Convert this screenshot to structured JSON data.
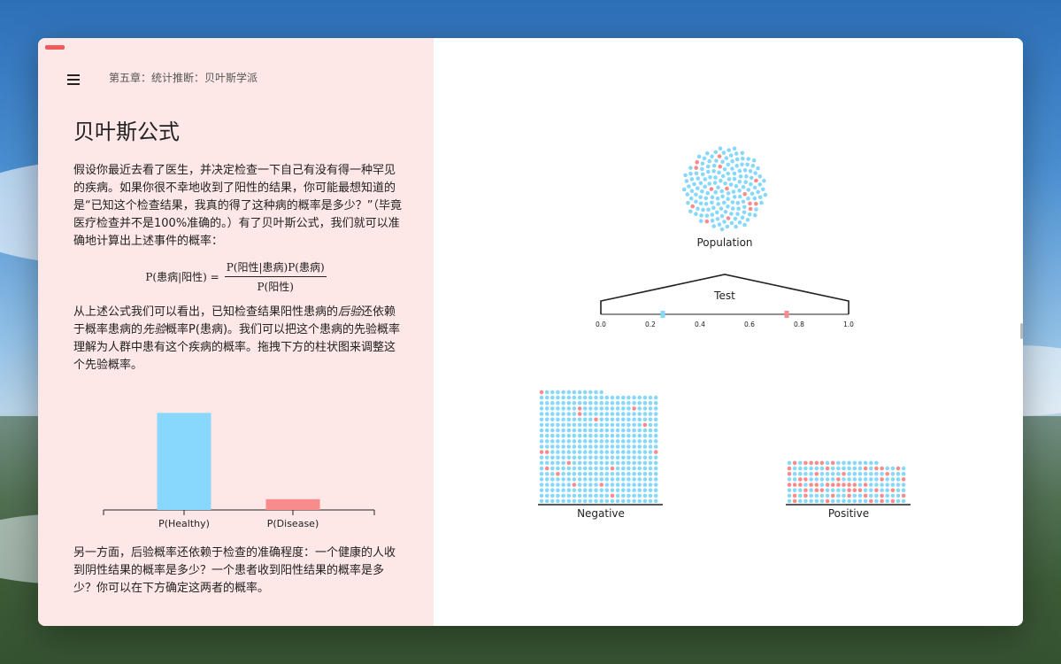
{
  "window": {
    "breadcrumb": "第五章：统计推断：贝叶斯学派"
  },
  "article": {
    "title": "贝叶斯公式",
    "para1": "假设你最近去看了医生，并决定检查一下自己有没有得一种罕见的疾病。如果你很不幸地收到了阳性的结果，你可能最想知道的是“已知这个检查结果，我真的得了这种病的概率是多少？”（毕竟医疗检查并不是100%准确的。）有了贝叶斯公式，我们就可以准确地计算出上述事件的概率：",
    "formula_lhs": "P(患病|阳性) =",
    "formula_num": "P(阳性|患病)P(患病)",
    "formula_den": "P(阳性)",
    "para2_a": "从上述公式我们可以看出，已知检查结果阳性患病的",
    "para2_em1": "后验",
    "para2_b": "还依赖于概率患病的",
    "para2_em2": "先验",
    "para2_c": "概率P(患病)。我们可以把这个患病的先验概率理解为人群中患有这个疾病的概率。拖拽下方的柱状图来调整这个先验概率。",
    "para3": "另一方面，后验概率还依赖于检查的准确程度：一个健康的人收到阴性结果的概率是多少？一个患者收到阳性结果的概率是多少？你可以在下方确定这两者的概率。"
  },
  "chart_data": [
    {
      "type": "bar",
      "categories": [
        "P(Healthy)",
        "P(Disease)"
      ],
      "values": [
        0.9,
        0.1
      ],
      "ylim": [
        0,
        1
      ],
      "colors": [
        "#87d8fb",
        "#f88b8b"
      ]
    }
  ],
  "visualization": {
    "population_label": "Population",
    "test_label": "Test",
    "axis_ticks": [
      "0.0",
      "0.2",
      "0.4",
      "0.6",
      "0.8",
      "1.0"
    ],
    "healthy_marker": 0.25,
    "disease_marker": 0.75,
    "negative_label": "Negative",
    "positive_label": "Positive",
    "colors": {
      "healthy": "#87d8fb",
      "disease": "#f88b8b"
    }
  }
}
